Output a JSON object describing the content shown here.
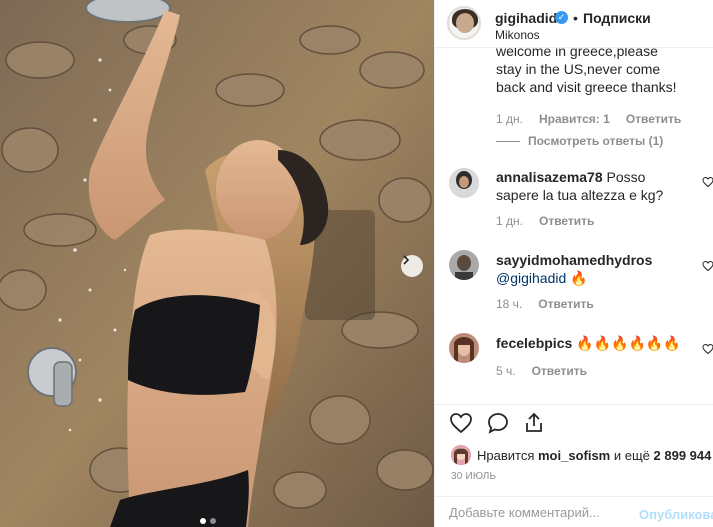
{
  "post": {
    "username": "gigihadid",
    "follow_separator": "•",
    "follow_label": "Подписки",
    "location": "Mikonos"
  },
  "comments": [
    {
      "id": "c1",
      "text": "welcome in greece,please stay in the US,never come back and visit greece thanks!",
      "time": "1 дн.",
      "likes": "Нравится: 1",
      "reply": "Ответить",
      "view_replies": "Посмотреть ответы (1)"
    },
    {
      "id": "c2",
      "username": "annalisazema78",
      "text": " Posso sapere la tua altezza e kg?",
      "time": "1 дн.",
      "reply": "Ответить"
    },
    {
      "id": "c3",
      "username": "sayyidmohamedhydros",
      "mention": "@gigihadid",
      "emoji": "🔥",
      "time": "18 ч.",
      "reply": "Ответить"
    },
    {
      "id": "c4",
      "username": "fecelebpics",
      "emoji": "🔥🔥🔥🔥🔥🔥",
      "time": "5 ч.",
      "reply": "Ответить"
    }
  ],
  "actions": {
    "likes_prefix": "Нравится",
    "likes_user": "moi_sofism",
    "likes_suffix": "и ещё",
    "likes_count": "2 899 944",
    "date": "30 ИЮЛЬ"
  },
  "add_comment": {
    "placeholder": "Добавьте комментарий...",
    "publish_label": "Опубликовать"
  },
  "colors": {
    "verified": "#3897f0",
    "publish_disabled": "#b2dffc",
    "fire": "#ff6a00"
  }
}
